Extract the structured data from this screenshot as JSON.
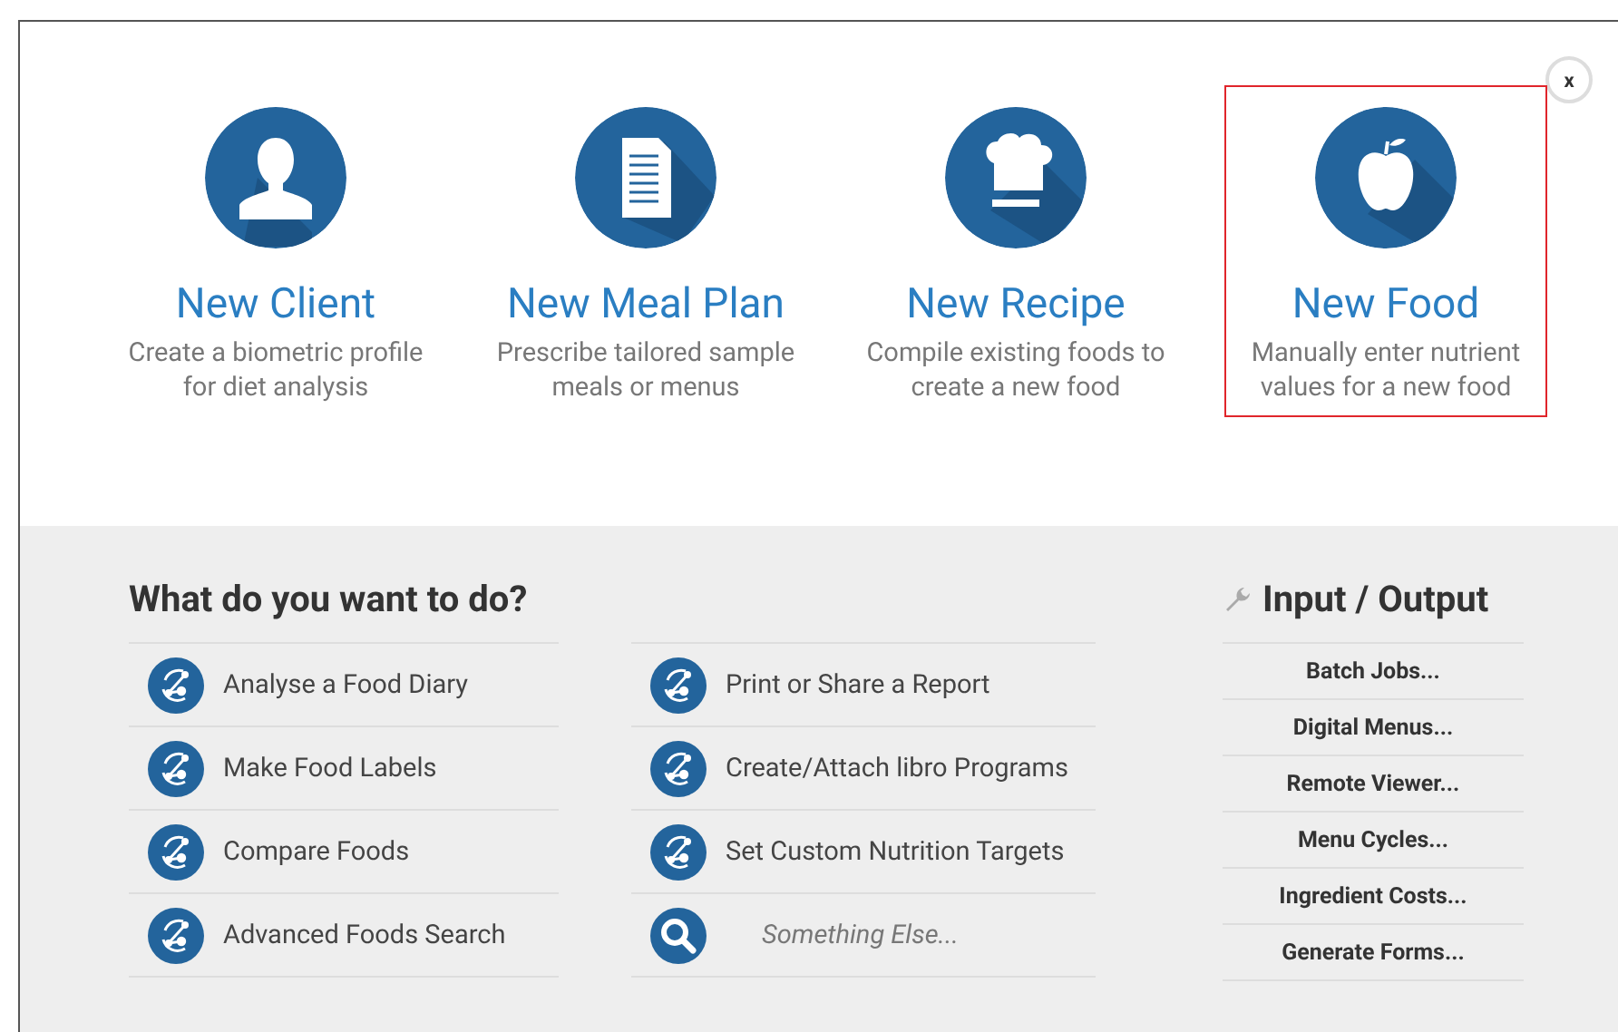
{
  "close_button": {
    "label": "x"
  },
  "tiles": [
    {
      "kind": "client",
      "title": "New Client",
      "description": "Create a biometric profile for diet analysis",
      "selected": false
    },
    {
      "kind": "meal-plan",
      "title": "New Meal Plan",
      "description": "Prescribe tailored sample meals or menus",
      "selected": false
    },
    {
      "kind": "recipe",
      "title": "New Recipe",
      "description": "Compile existing foods to create a new food",
      "selected": false
    },
    {
      "kind": "food",
      "title": "New Food",
      "description": "Manually enter nutrient values for a new food",
      "selected": true
    }
  ],
  "tasks": {
    "heading": "What do you want to do?",
    "columns": [
      [
        {
          "kind": "action",
          "label": "Analyse a Food Diary"
        },
        {
          "kind": "action",
          "label": "Make Food Labels"
        },
        {
          "kind": "action",
          "label": "Compare Foods"
        },
        {
          "kind": "action",
          "label": "Advanced Foods Search"
        }
      ],
      [
        {
          "kind": "action",
          "label": "Print or Share a Report"
        },
        {
          "kind": "action",
          "label": "Create/Attach libro Programs"
        },
        {
          "kind": "action",
          "label": "Set Custom Nutrition Targets"
        },
        {
          "kind": "search",
          "label": "Something Else..."
        }
      ]
    ]
  },
  "input_output": {
    "heading": "Input / Output",
    "items": [
      "Batch Jobs...",
      "Digital Menus...",
      "Remote Viewer...",
      "Menu Cycles...",
      "Ingredient Costs...",
      "Generate Forms..."
    ]
  }
}
